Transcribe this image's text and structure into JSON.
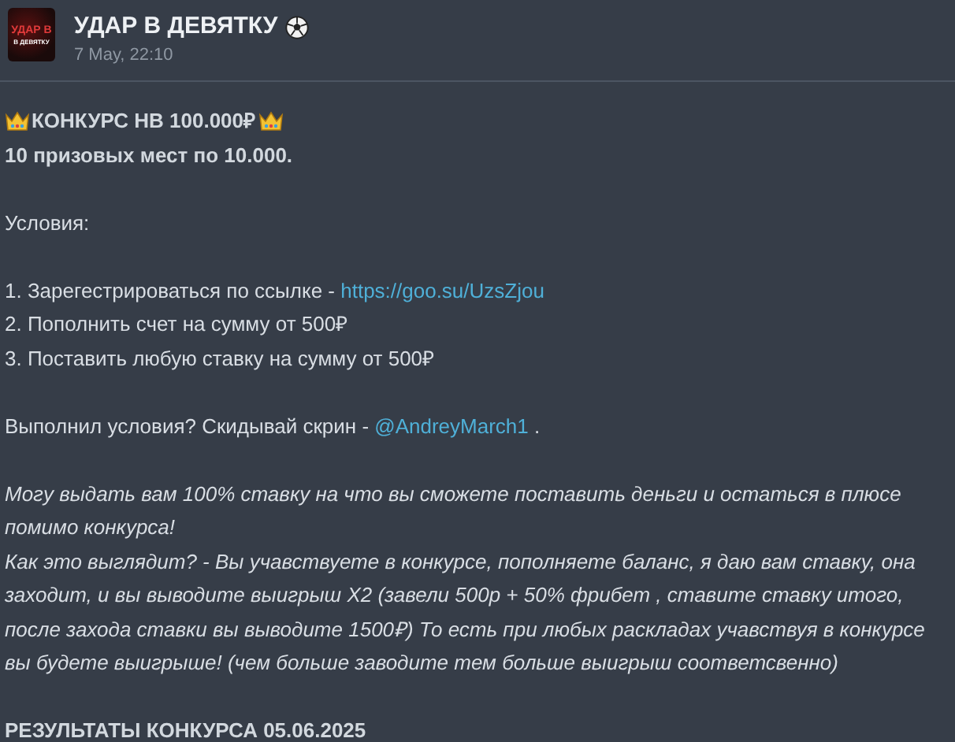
{
  "channel": {
    "name": "УДАР В ДЕВЯТКУ",
    "date": "7 May, 22:10",
    "avatar_lines": [
      "УДАР В",
      "В ДЕВЯТКУ"
    ]
  },
  "post": {
    "paragraphs": [
      {
        "lines": [
          {
            "kind": "crown-heading",
            "parts": [
              {
                "kind": "plain",
                "text": "КОНКУРС НВ 100.000₽"
              }
            ]
          },
          {
            "kind": "bold",
            "parts": [
              {
                "kind": "plain",
                "text": "10 призовых мест по 10.000."
              }
            ]
          }
        ]
      },
      {
        "lines": [
          {
            "kind": "plain",
            "parts": [
              {
                "kind": "plain",
                "text": "Условия:"
              }
            ]
          }
        ]
      },
      {
        "lines": [
          {
            "kind": "plain",
            "parts": [
              {
                "kind": "plain",
                "text": "1. Зарегестрироваться по ссылке - "
              },
              {
                "kind": "link",
                "text": "https://goo.su/UzsZjou"
              }
            ]
          },
          {
            "kind": "plain",
            "parts": [
              {
                "kind": "plain",
                "text": "2. Пополнить счет на сумму от 500₽"
              }
            ]
          },
          {
            "kind": "plain",
            "parts": [
              {
                "kind": "plain",
                "text": "3. Поставить любую ставку на сумму от 500₽"
              }
            ]
          }
        ]
      },
      {
        "lines": [
          {
            "kind": "plain",
            "parts": [
              {
                "kind": "plain",
                "text": "Выполнил условия? Скидывай скрин - "
              },
              {
                "kind": "link",
                "text": "@AndreyMarch1"
              },
              {
                "kind": "plain",
                "text": " ."
              }
            ]
          }
        ]
      },
      {
        "lines": [
          {
            "kind": "italic",
            "parts": [
              {
                "kind": "plain",
                "text": "Могу выдать вам 100% ставку на что вы сможете поставить деньги и остаться в плюсе помимо конкурса!"
              }
            ]
          },
          {
            "kind": "italic",
            "parts": [
              {
                "kind": "plain",
                "text": "Как это выглядит? - Вы учавствуете в конкурсе, пополняете баланс, я даю вам ставку, она заходит, и вы выводите выигрыш X2 (завели 500р + 50% фрибет , ставите ставку итого, после захода ставки вы выводите 1500₽) То есть при любых раскладах учавствуя в конкурсе вы будете выигрыше! (чем больше заводите тем больше выигрыш соответсвенно)"
              }
            ]
          }
        ]
      },
      {
        "lines": [
          {
            "kind": "bold",
            "parts": [
              {
                "kind": "plain",
                "text": "РЕЗУЛЬТАТЫ КОНКУРСА 05.06.2025"
              }
            ]
          }
        ]
      }
    ]
  }
}
